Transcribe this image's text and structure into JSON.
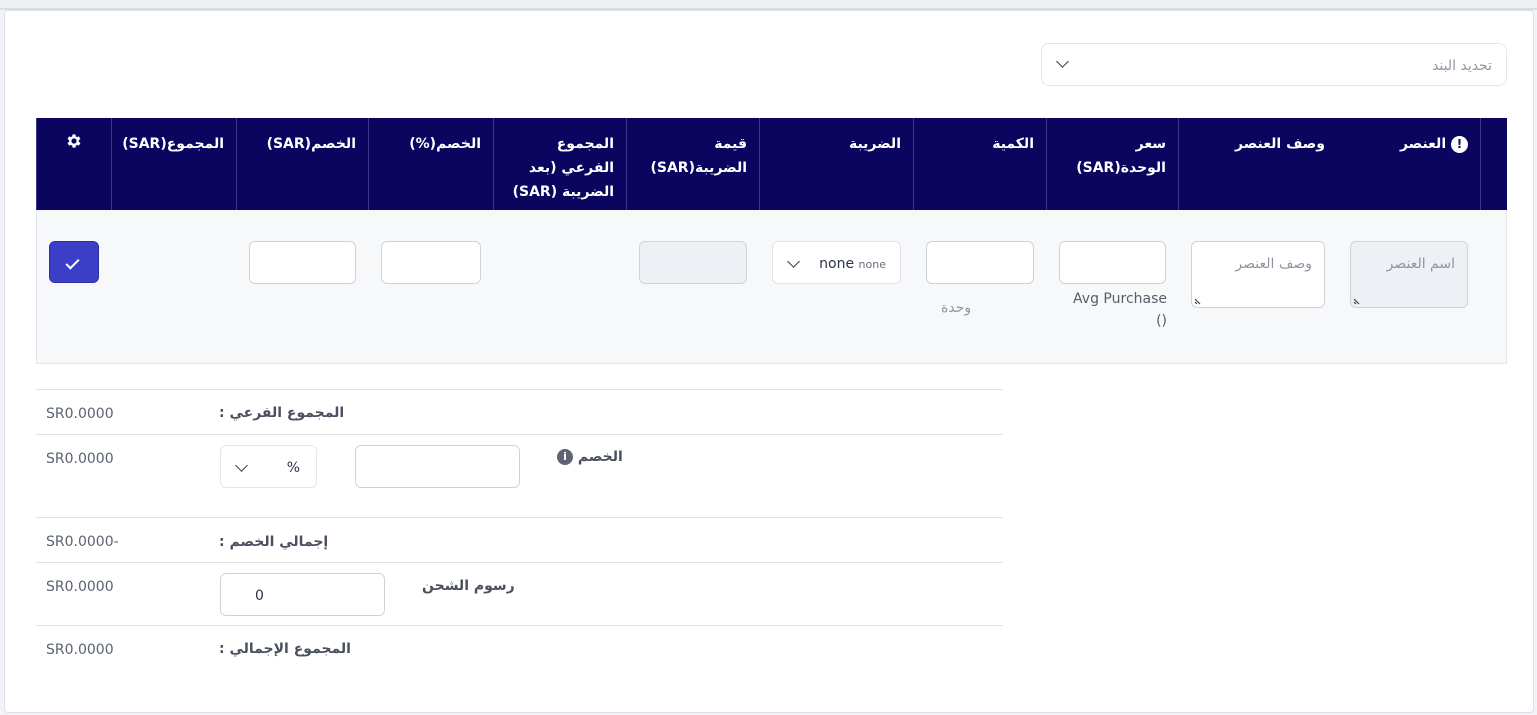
{
  "item_select": {
    "placeholder": "تحديد البند"
  },
  "table": {
    "headers": {
      "item": "العنصر",
      "description": "وصف العنصر",
      "unit_price": "سعر الوحدة(SAR)",
      "quantity": "الكمية",
      "tax": "الضريبة",
      "tax_value": "قيمة الضريبة(SAR)",
      "subtotal_after_tax": "المجموع الفرعي (بعد الضريبة (SAR)",
      "discount_pct": "الخصم(%)",
      "discount_sar": "الخصم(SAR)",
      "total": "المجموع(SAR)"
    },
    "row": {
      "item_placeholder": "اسم العنصر",
      "description_placeholder": "وصف العنصر",
      "avg_purchase_label": "Avg Purchase ()",
      "unit_label": "وحدة",
      "tax_value": "none",
      "tax_value_small": "none"
    }
  },
  "summary": {
    "subtotal": {
      "label": "المجموع الفرعي :",
      "value": "SR0.0000"
    },
    "discount": {
      "label": "الخصم",
      "type": "%",
      "value": "SR0.0000"
    },
    "total_discount": {
      "label": "إجمالي الخصم :",
      "value": "-SR0.0000"
    },
    "shipping": {
      "label": "رسوم الشحن",
      "input_value": "0",
      "value": "SR0.0000"
    },
    "grand_total": {
      "label": "المجموع الإجمالي :",
      "value": "SR0.0000"
    }
  }
}
